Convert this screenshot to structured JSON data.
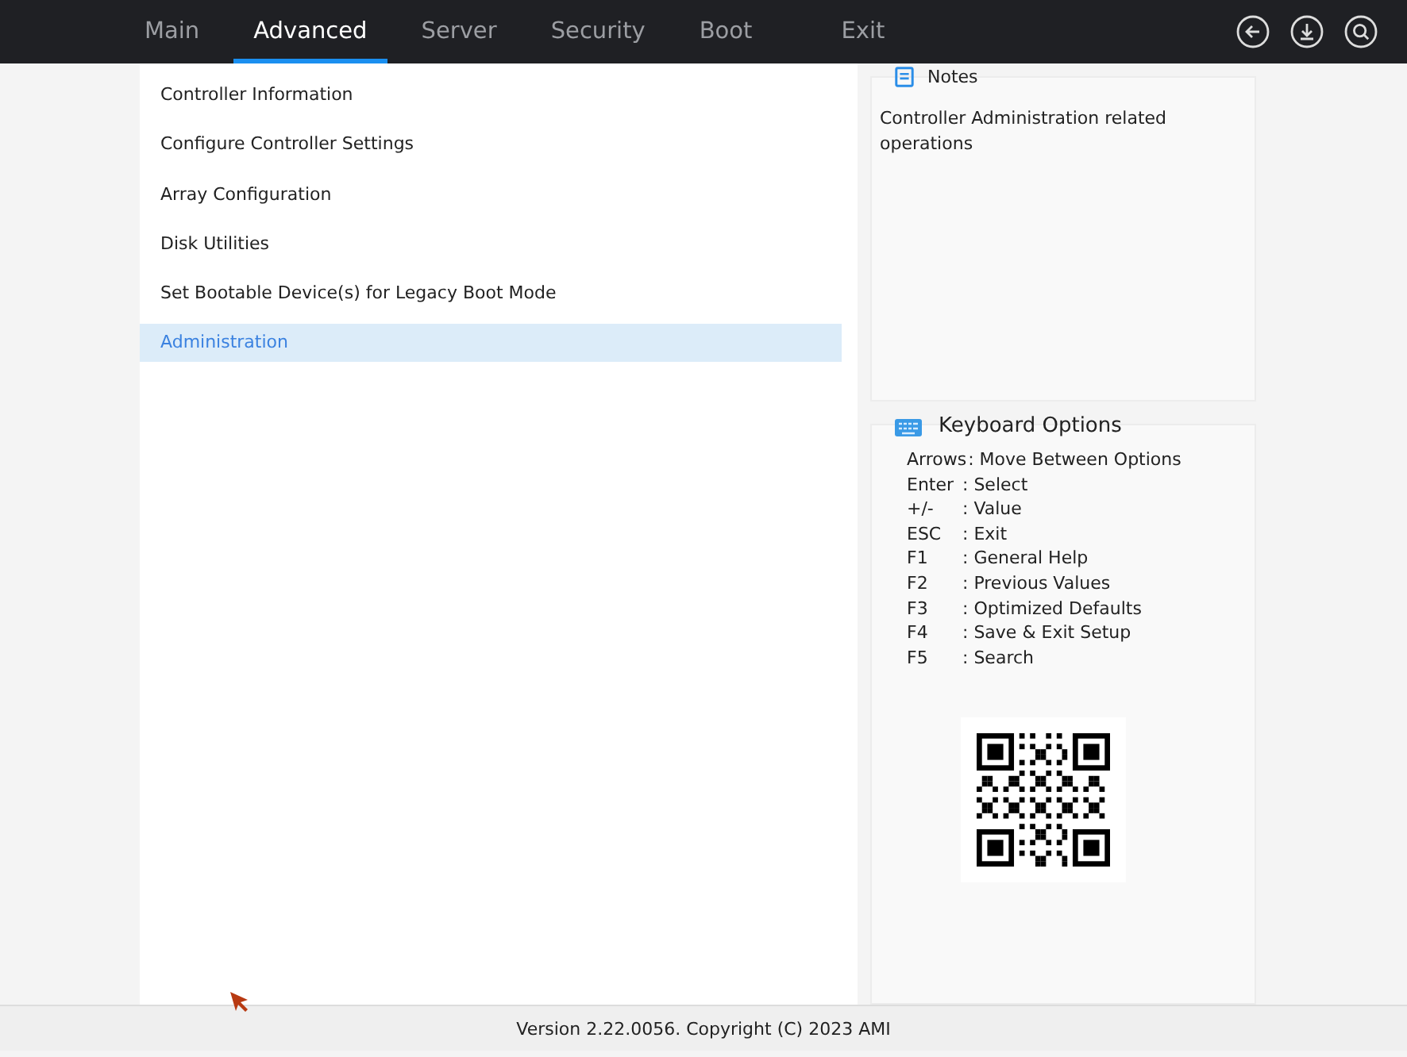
{
  "tabs": [
    {
      "label": "Main",
      "selected": false
    },
    {
      "label": "Advanced",
      "selected": true
    },
    {
      "label": "Server",
      "selected": false
    },
    {
      "label": "Security",
      "selected": false
    },
    {
      "label": "Boot",
      "selected": false
    },
    {
      "label": "Exit",
      "selected": false
    }
  ],
  "menu": [
    {
      "label": "Controller Information",
      "selected": false
    },
    {
      "label": "Configure Controller Settings",
      "selected": false
    },
    {
      "label": "Array Configuration",
      "selected": false
    },
    {
      "label": "Disk Utilities",
      "selected": false
    },
    {
      "label": "Set Bootable Device(s) for Legacy Boot Mode",
      "selected": false
    },
    {
      "label": "Administration",
      "selected": true
    }
  ],
  "notes": {
    "title": "Notes",
    "text": "Controller Administration related operations"
  },
  "keyboard_options": {
    "title": "Keyboard Options",
    "keys": [
      {
        "key": "Arrows",
        "action": ": Move Between Options"
      },
      {
        "key": "Enter",
        "action": ": Select"
      },
      {
        "key": "+/-",
        "action": ": Value"
      },
      {
        "key": "ESC",
        "action": ": Exit"
      },
      {
        "key": "F1",
        "action": ": General Help"
      },
      {
        "key": "F2",
        "action": ": Previous Values"
      },
      {
        "key": "F3",
        "action": ": Optimized Defaults"
      },
      {
        "key": "F4",
        "action": ": Save & Exit Setup"
      },
      {
        "key": "F5",
        "action": ": Search"
      }
    ]
  },
  "footer": "Version 2.22.0056. Copyright (C) 2023 AMI"
}
